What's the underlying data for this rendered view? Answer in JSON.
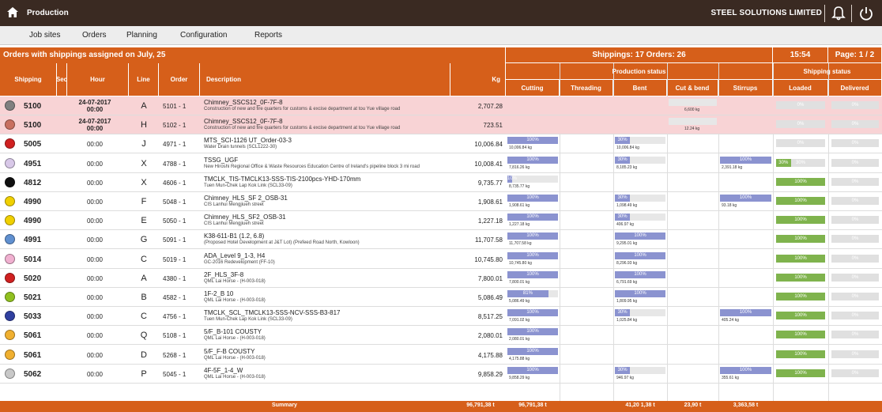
{
  "app": {
    "title": "Production",
    "company": "STEEL SOLUTIONS LIMITED"
  },
  "menu": [
    "Job sites",
    "Orders",
    "Planning",
    "Configuration",
    "Reports"
  ],
  "banner": {
    "orders_title": "Orders with shippings assigned on  July, 25",
    "shippings": "Shippings: 17  Orders: 26",
    "time": "15:54",
    "page": "Page: 1 / 2"
  },
  "columns": {
    "shipping": "Shipping",
    "sec": "Sec",
    "hour": "Hour",
    "line": "Line",
    "order": "Order",
    "description": "Description",
    "kg": "Kg",
    "production_status": "Production status",
    "cutting": "Cutting",
    "threading": "Threading",
    "bent": "Bent",
    "cut_bend": "Cut & bend",
    "stirrups": "Stirrups",
    "shipping_status": "Shipping status",
    "loaded": "Loaded",
    "delivered": "Delivered"
  },
  "rows": [
    {
      "color": "#808080",
      "ship": "5100",
      "hour": "24-07-2017\n00:00",
      "line": "A",
      "order": "5101 - 1",
      "desc1": "Chimney_SSCS12_0F-7F-8",
      "desc2": "Construction of new and fire quarters for customs & excise department at tou Yue village road",
      "kg": "2,707.28",
      "hl": true,
      "cutbend_sub": "6,600 kg",
      "loaded": 0,
      "delivered": 0
    },
    {
      "color": "#c87060",
      "ship": "5100",
      "hour": "24-07-2017\n00:00",
      "line": "H",
      "order": "5102 - 1",
      "desc1": "Chimney_SSCS12_0F-7F-8",
      "desc2": "Construction of new and fire quarters for customs & excise department at tou Yue village road",
      "kg": "723.51",
      "hl": true,
      "cutbend_sub": "12.24 kg",
      "loaded": 0,
      "delivered": 0
    },
    {
      "color": "#d02020",
      "ship": "5005",
      "hour": "00:00",
      "line": "J",
      "order": "4971 - 1",
      "desc1": "MTS_SCI-1126 UT_Order-03-3",
      "desc2": "Water Drain tunnels (SCL1222-30)",
      "kg": "10,006.84",
      "cut": 1.0,
      "cut_sub": "10,006.84 kg",
      "bent": 0.3,
      "bent_sub": "10,006.84 kg",
      "loaded": 0,
      "delivered": 0
    },
    {
      "color": "#d8c8e8",
      "ship": "4951",
      "hour": "00:00",
      "line": "X",
      "order": "4788 - 1",
      "desc1": "TSSG_UGF",
      "desc2": "New Hiroshi Regional Office & Waste Resources Education Centre of Ireland's pipeline block 3 mi road",
      "kg": "10,008.41",
      "cut": 1.0,
      "cut_sub": "7,816.26 kg",
      "bent": 0.3,
      "bent_sub": "8,185.23 kg",
      "stir": 1.0,
      "stir_sub": "2,391.18 kg",
      "loaded": 0.3,
      "delivered": 0
    },
    {
      "color": "#101010",
      "ship": "4812",
      "hour": "00:00",
      "line": "X",
      "order": "4606 - 1",
      "desc1": "TMCLK_TIS-TMCLK13-SSS-TIS-2100pcs-YHD-170mm",
      "desc2": "Tuen Mun-Chek Lap Kok Link (SCL33-09)",
      "kg": "9,735.77",
      "cut": 0.1,
      "cut_sub": "8,735.77 kg",
      "loaded": 1.0,
      "delivered": 0
    },
    {
      "color": "#f0d000",
      "ship": "4990",
      "hour": "00:00",
      "line": "F",
      "order": "5048 - 1",
      "desc1": "Chimney_HLS_SF 2_OSB-31",
      "desc2": "CIS Lanhui Mengjiueh street",
      "kg": "1,908.61",
      "cut": 1.0,
      "cut_sub": "1,908.61 kg",
      "bent": 0.3,
      "bent_sub": "1,098.49 kg",
      "stir": 1.0,
      "stir_sub": "93.18 kg",
      "loaded": 1.0,
      "delivered": 0
    },
    {
      "color": "#f0d000",
      "ship": "4990",
      "hour": "00:00",
      "line": "E",
      "order": "5050 - 1",
      "desc1": "Chimney_HLS_SF2_OSB-31",
      "desc2": "CIS Lanhui Mengjiueh street",
      "kg": "1,227.18",
      "cut": 1.0,
      "cut_sub": "1,227.18 kg",
      "bent": 0.3,
      "bent_sub": "406.97 kg",
      "loaded": 1.0,
      "delivered": 0
    },
    {
      "color": "#6090d0",
      "ship": "4991",
      "hour": "00:00",
      "line": "G",
      "order": "5091 - 1",
      "desc1": "K38-611-B1 (1.2, 6.8)",
      "desc2": "(Proposed Hotel Development at J&T Lot) (Prefeed Road North, Kowloon)",
      "kg": "11,707.58",
      "cut": 1.0,
      "cut_sub": "11,707.58 kg",
      "bent": 1.0,
      "bent_sub": "9,295.01 kg",
      "loaded": 1.0,
      "delivered": 0
    },
    {
      "color": "#f0b0d0",
      "ship": "5014",
      "hour": "00:00",
      "line": "C",
      "order": "5019 - 1",
      "desc1": "ADA_Level 9_1-3, H4",
      "desc2": "GC-2016 Redevelopment (FF-10)",
      "kg": "10,745.80",
      "cut": 1.0,
      "cut_sub": "10,745.80 kg",
      "bent": 1.0,
      "bent_sub": "8,296.93 kg",
      "loaded": 1.0,
      "delivered": 0
    },
    {
      "color": "#d02020",
      "ship": "5020",
      "hour": "00:00",
      "line": "A",
      "order": "4380 - 1",
      "desc1": "2F_HLS_3F-8",
      "desc2": "QML Lai Horse - (H-003-018)",
      "kg": "7,800.01",
      "cut": 1.0,
      "cut_sub": "7,800.01 kg",
      "bent": 1.0,
      "bent_sub": "6,791.69 kg",
      "loaded": 1.0,
      "delivered": 0
    },
    {
      "color": "#90c020",
      "ship": "5021",
      "hour": "00:00",
      "line": "B",
      "order": "4582 - 1",
      "desc1": "1F-2_B 10",
      "desc2": "QML Lai Horse - (H-003-018)",
      "kg": "5,086.49",
      "cut": 0.81,
      "cut_sub": "5,086.49 kg",
      "bent": 1.0,
      "bent_sub": "1,809.95 kg",
      "loaded": 1.0,
      "delivered": 0
    },
    {
      "color": "#3040a0",
      "ship": "5033",
      "hour": "00:00",
      "line": "C",
      "order": "4756 - 1",
      "desc1": "TMCLK_SCL_TMCLK13-SSS-NCV-SSS-B3-817",
      "desc2": "Tuen Mun-Chek Lap Kok Link (SCL33-09)",
      "kg": "8,517.25",
      "cut": 1.0,
      "cut_sub": "7,091.02 kg",
      "bent": 0.3,
      "bent_sub": "1,025.84 kg",
      "stir": 1.0,
      "stir_sub": "405.24 kg",
      "loaded": 1.0,
      "delivered": 0
    },
    {
      "color": "#f0b030",
      "ship": "5061",
      "hour": "00:00",
      "line": "Q",
      "order": "5108 - 1",
      "desc1": "5/F_B-101 COUSTY",
      "desc2": "QML Lai Horse - (H-003-018)",
      "kg": "2,080.01",
      "cut": 1.0,
      "cut_sub": "2,080.01 kg",
      "loaded": 1.0,
      "delivered": 0
    },
    {
      "color": "#f0b030",
      "ship": "5061",
      "hour": "00:00",
      "line": "D",
      "order": "5268 - 1",
      "desc1": "5/F_F-B COUSTY",
      "desc2": "QML Lai Horse - (H-003-018)",
      "kg": "4,175.88",
      "cut": 1.0,
      "cut_sub": "4,175.88 kg",
      "loaded": 1.0,
      "delivered": 0
    },
    {
      "color": "#c8c8c8",
      "ship": "5062",
      "hour": "00:00",
      "line": "P",
      "order": "5045 - 1",
      "desc1": "4F-5F_1-4_W",
      "desc2": "QML Lai Horse - (H-003-018)",
      "kg": "9,858.29",
      "cut": 1.0,
      "cut_sub": "9,858.29 kg",
      "bent": 0.3,
      "bent_sub": "946.97 kg",
      "stir": 1.0,
      "stir_sub": "355.61 kg",
      "loaded": 1.0,
      "delivered": 0
    }
  ],
  "summary": {
    "label": "Summary",
    "kg": "96,791,38 t",
    "cut": "96,791,38 t",
    "bent": "41,20 1,38 t",
    "cutbend": "23,90 t",
    "stir": "3,363,58 t"
  },
  "colors": {
    "accent": "#d65f1a",
    "topbar": "#3a2a22",
    "cut_bar": "#8b93d0",
    "loaded_bar": "#7fb34d",
    "highlight_row": "#f8d3d5"
  }
}
